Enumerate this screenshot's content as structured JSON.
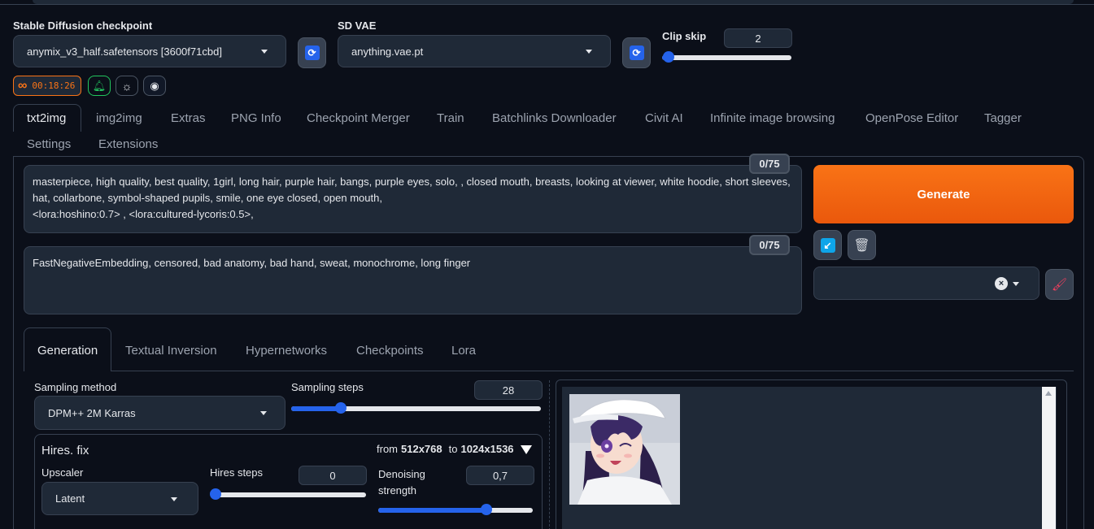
{
  "checkpoint": {
    "label": "Stable Diffusion checkpoint",
    "value": "anymix_v3_half.safetensors [3600f71cbd]"
  },
  "vae": {
    "label": "SD VAE",
    "value": "anything.vae.pt"
  },
  "clip_skip": {
    "label": "Clip skip",
    "value": "2",
    "level": 0.05
  },
  "status": {
    "timer": "00:18:26"
  },
  "tabs": [
    "txt2img",
    "img2img",
    "Extras",
    "PNG Info",
    "Checkpoint Merger",
    "Train",
    "Batchlinks Downloader",
    "Civit AI",
    "Infinite image browsing",
    "OpenPose Editor",
    "Tagger",
    "Settings",
    "Extensions"
  ],
  "prompt": {
    "positive": "masterpiece, high quality, best quality, 1girl, long hair, purple hair, bangs, purple eyes, solo, , closed mouth, breasts, looking at viewer, white hoodie, short sleeves, hat, collarbone, symbol-shaped pupils, smile, one eye closed, open mouth,\n<lora:hoshino:0.7> , <lora:cultured-lycoris:0.5>,",
    "positive_count": "0/75",
    "negative": "FastNegativeEmbedding, censored, bad anatomy, bad hand, sweat, monochrome, long finger",
    "negative_count": "0/75"
  },
  "generate_label": "Generate",
  "subtabs": [
    "Generation",
    "Textual Inversion",
    "Hypernetworks",
    "Checkpoints",
    "Lora"
  ],
  "sampling": {
    "method_label": "Sampling method",
    "method_value": "DPM++ 2M Karras",
    "steps_label": "Sampling steps",
    "steps_value": "28",
    "steps_level": 0.2
  },
  "hires": {
    "title": "Hires. fix",
    "from_text": "from",
    "from_res": "512x768",
    "to_text": "to",
    "to_res": "1024x1536",
    "upscaler_label": "Upscaler",
    "upscaler_value": "Latent",
    "steps_label": "Hires steps",
    "steps_value": "0",
    "steps_level": 0.0,
    "denoise_label_1": "Denoising",
    "denoise_label_2": "strength",
    "denoise_value": "0,7",
    "denoise_level": 0.7
  },
  "colors": {
    "accent": "#2563eb",
    "generate": "#f97316",
    "background": "#0b0f19"
  }
}
